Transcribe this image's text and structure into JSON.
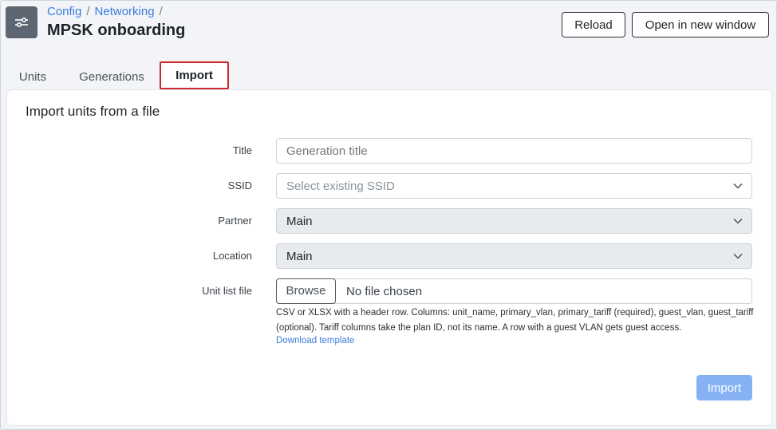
{
  "breadcrumb": {
    "items": [
      "Config",
      "Networking"
    ],
    "separator": "/"
  },
  "page": {
    "title": "MPSK onboarding",
    "icon": "sliders-icon"
  },
  "header_buttons": {
    "reload": "Reload",
    "open_new_window": "Open in new window"
  },
  "tabs": [
    {
      "label": "Units",
      "active": false
    },
    {
      "label": "Generations",
      "active": false
    },
    {
      "label": "Import",
      "active": true
    }
  ],
  "form": {
    "title": "Import units from a file",
    "title_field": {
      "label": "Title",
      "value": "",
      "placeholder": "Generation title"
    },
    "ssid": {
      "label": "SSID",
      "value": "Select existing SSID",
      "placeholder": true
    },
    "partner": {
      "label": "Partner",
      "value": "Main",
      "disabled": true
    },
    "location": {
      "label": "Location",
      "value": "Main",
      "disabled": true
    },
    "unit_list_file": {
      "label": "Unit list file",
      "browse_label": "Browse",
      "status": "No file chosen"
    },
    "help_text": "CSV or XLSX with a header row. Columns: unit_name, primary_vlan, primary_tariff (required), guest_vlan, guest_tariff (optional). Tariff columns take the plan ID, not its name. A row with a guest VLAN gets guest access.",
    "download_link": "Download template",
    "submit_label": "Import"
  },
  "colors": {
    "accent": "#3b7ddd",
    "active_tab_border": "#d0262d",
    "import_button_disabled": "#86b2f5"
  }
}
